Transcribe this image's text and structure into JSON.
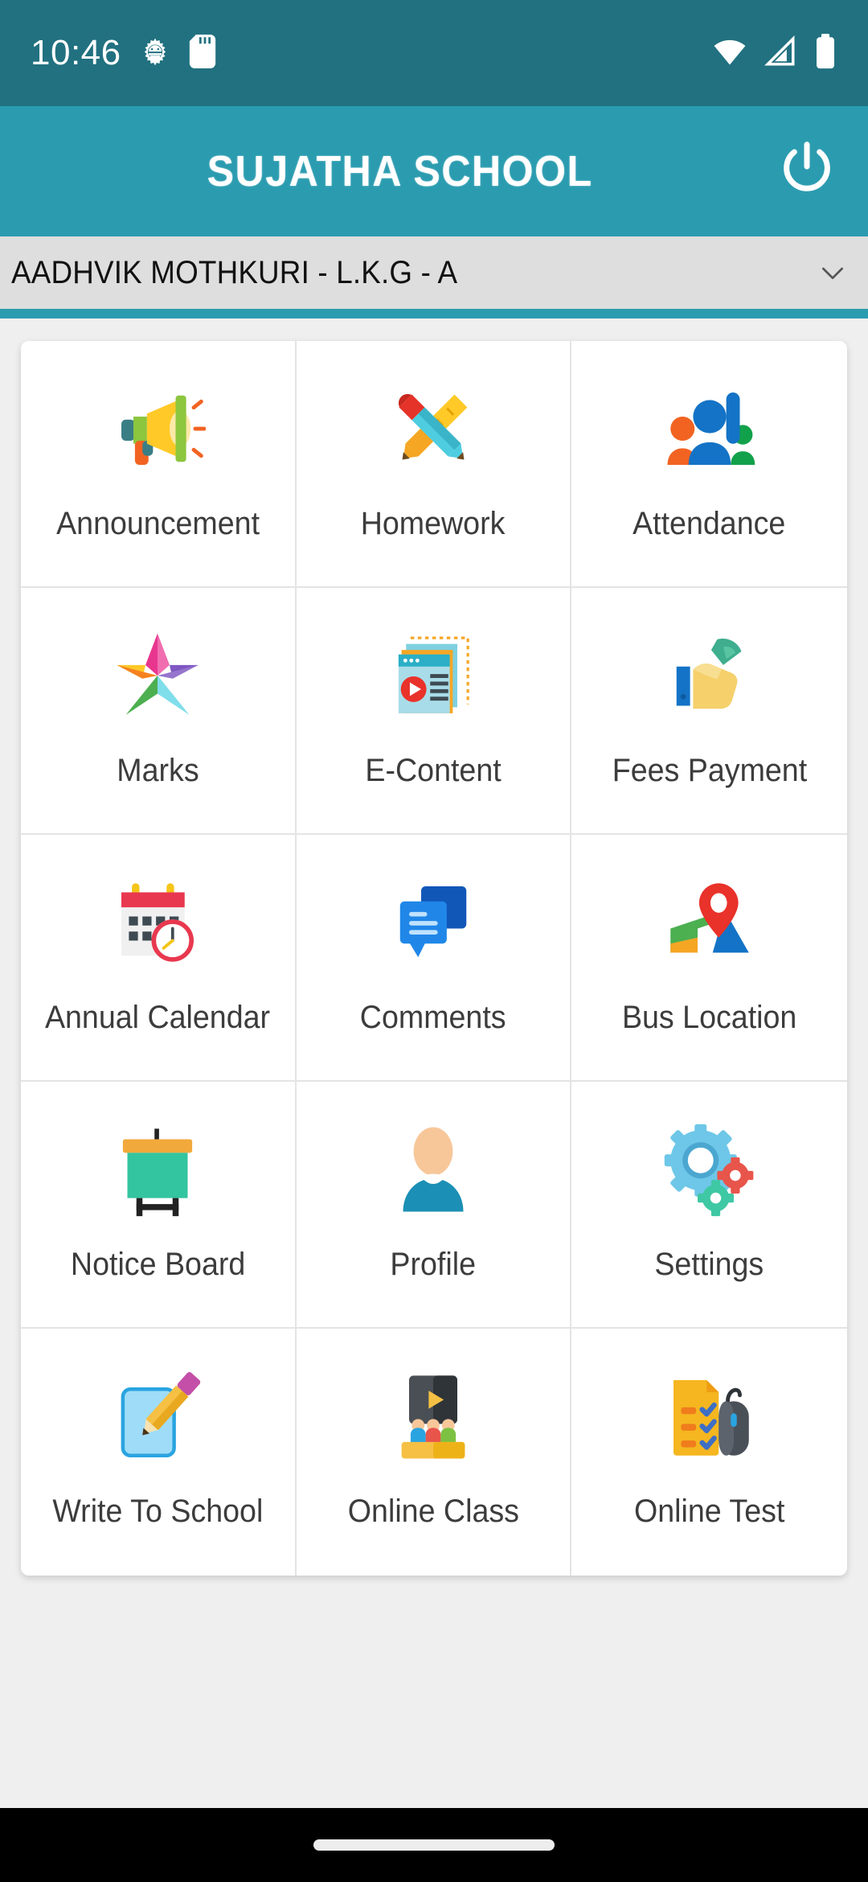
{
  "status_bar": {
    "time": "10:46",
    "icons_left": [
      "android-debug-icon",
      "sd-card-icon"
    ],
    "icons_right": [
      "wifi-icon",
      "cellular-signal-icon",
      "battery-icon"
    ],
    "background_color": "#217180"
  },
  "app_bar": {
    "title": "SUJATHA SCHOOL",
    "logout_icon": "power-icon",
    "background_color": "#2B9CB0"
  },
  "student_selector": {
    "value": "AADHVIK MOTHKURI - L.K.G - A",
    "chevron_icon": "chevron-down-icon",
    "background_color": "#DEDEDE"
  },
  "menu": {
    "tiles": [
      {
        "label": "Announcement",
        "icon": "megaphone-icon"
      },
      {
        "label": "Homework",
        "icon": "pencil-ruler-icon"
      },
      {
        "label": "Attendance",
        "icon": "people-raised-hand-icon"
      },
      {
        "label": "Marks",
        "icon": "star-icon"
      },
      {
        "label": "E-Content",
        "icon": "media-documents-icon"
      },
      {
        "label": "Fees Payment",
        "icon": "hand-money-icon"
      },
      {
        "label": "Annual Calendar",
        "icon": "calendar-clock-icon"
      },
      {
        "label": "Comments",
        "icon": "chat-bubbles-icon"
      },
      {
        "label": "Bus Location",
        "icon": "map-pin-icon"
      },
      {
        "label": "Notice Board",
        "icon": "notice-board-icon"
      },
      {
        "label": "Profile",
        "icon": "person-avatar-icon"
      },
      {
        "label": "Settings",
        "icon": "gears-icon"
      },
      {
        "label": "Write To School",
        "icon": "note-pencil-icon"
      },
      {
        "label": "Online Class",
        "icon": "screen-students-icon"
      },
      {
        "label": "Online Test",
        "icon": "checklist-mouse-icon"
      }
    ]
  },
  "nav_bar": {
    "gesture_pill": "home-gesture-pill",
    "background_color": "#000000"
  }
}
